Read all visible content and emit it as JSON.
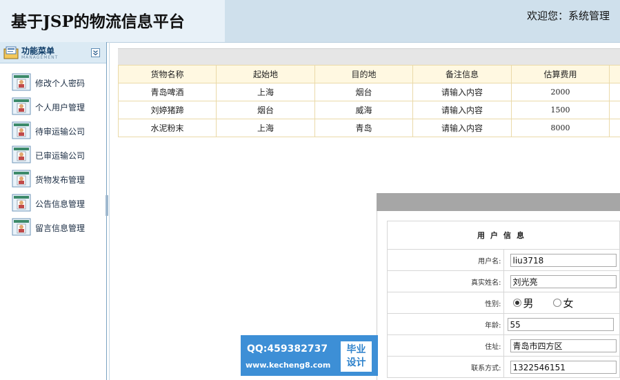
{
  "header": {
    "title": "基于JSP的物流信息平台",
    "welcome": "欢迎您：系统管理"
  },
  "sidebar": {
    "title": "功能菜单",
    "subtitle": "MANAGEMENT",
    "items": [
      {
        "label": "修改个人密码",
        "icon": "user-card-icon"
      },
      {
        "label": "个人用户管理",
        "icon": "user-card-icon"
      },
      {
        "label": "待审运输公司",
        "icon": "user-card-icon"
      },
      {
        "label": "已审运输公司",
        "icon": "user-card-icon"
      },
      {
        "label": "货物发布管理",
        "icon": "user-card-icon"
      },
      {
        "label": "公告信息管理",
        "icon": "user-card-icon"
      },
      {
        "label": "留言信息管理",
        "icon": "user-card-icon"
      }
    ]
  },
  "goods_table": {
    "headers": [
      "货物名称",
      "起始地",
      "目的地",
      "备注信息",
      "估算费用",
      ""
    ],
    "rows": [
      [
        "青岛啤酒",
        "上海",
        "烟台",
        "请输入内容",
        "2000",
        ""
      ],
      [
        "刘婷猪蹄",
        "烟台",
        "威海",
        "请输入内容",
        "1500",
        ""
      ],
      [
        "水泥粉末",
        "上海",
        "青岛",
        "请输入内容",
        "8000",
        ""
      ]
    ]
  },
  "user_info": {
    "caption": "用户信息",
    "fields": {
      "username": {
        "label": "用户名:",
        "value": "liu3718"
      },
      "realname": {
        "label": "真实姓名:",
        "value": "刘光亮"
      },
      "gender": {
        "label": "性别:",
        "options": [
          "男",
          "女"
        ],
        "selected": "男"
      },
      "age": {
        "label": "年龄:",
        "value": "55"
      },
      "address": {
        "label": "住址:",
        "value": "青岛市四方区"
      },
      "phone": {
        "label": "联系方式:",
        "value": "1322546151"
      }
    }
  },
  "watermark": {
    "qq": "QQ:459382737",
    "url": "www.kecheng8.com",
    "badge_line1": "毕业",
    "badge_line2": "设计"
  },
  "colors": {
    "header_bg": "#cfe0ec",
    "table_border": "#ead9a8",
    "table_header_bg": "#fff8e1",
    "watermark_bg": "#3d8fd6"
  }
}
